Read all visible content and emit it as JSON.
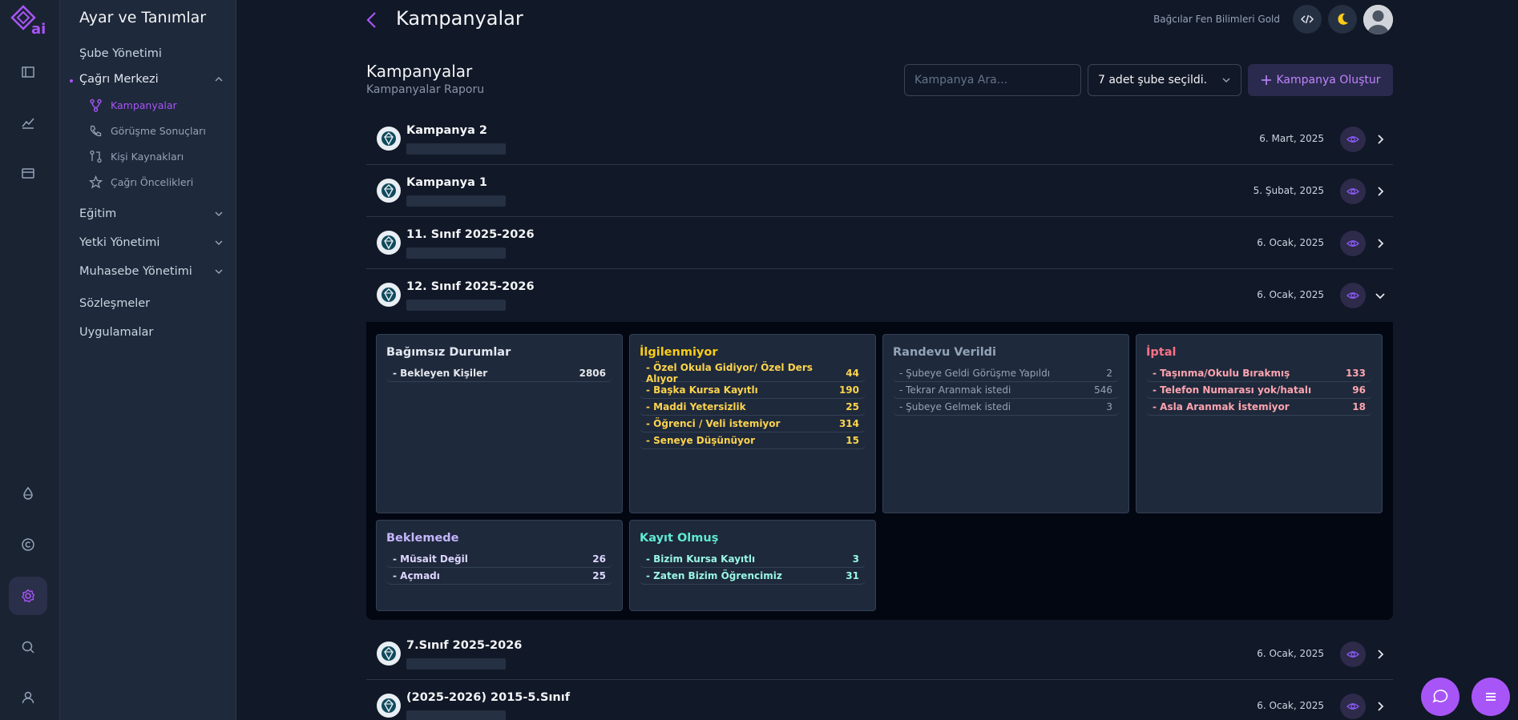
{
  "sidebar": {
    "title": "Ayar ve Tanımlar",
    "items": [
      {
        "label": "Şube Yönetimi"
      },
      {
        "label": "Çağrı Merkezi"
      },
      {
        "label": "Eğitim"
      },
      {
        "label": "Yetki Yönetimi"
      },
      {
        "label": "Muhasebe Yönetimi"
      },
      {
        "label": "Sözleşmeler"
      },
      {
        "label": "Uygulamalar"
      }
    ],
    "subitems": [
      {
        "label": "Kampanyalar",
        "icon": "branch-icon"
      },
      {
        "label": "Görüşme Sonuçları",
        "icon": "phone-icon"
      },
      {
        "label": "Kişi Kaynakları",
        "icon": "git-compare-icon"
      },
      {
        "label": "Çağrı Öncelikleri",
        "icon": "star-icon"
      }
    ]
  },
  "header": {
    "title": "Kampanyalar",
    "org": "Bağcılar Fen Bilimleri Gold"
  },
  "section": {
    "title": "Kampanyalar",
    "subtitle": "Kampanyalar Raporu",
    "search_placeholder": "Kampanya Ara...",
    "branch_select": "7 adet şube seçildi.",
    "create_label": "Kampanya Oluştur"
  },
  "campaigns": [
    {
      "name": "Kampanya 2",
      "date": "6. Mart, 2025"
    },
    {
      "name": "Kampanya 1",
      "date": "5. Şubat, 2025"
    },
    {
      "name": "11. Sınıf 2025-2026",
      "date": "6. Ocak, 2025"
    },
    {
      "name": "12. Sınıf 2025-2026",
      "date": "6. Ocak, 2025"
    },
    {
      "name": "7.Sınıf 2025-2026",
      "date": "6. Ocak, 2025"
    },
    {
      "name": "(2025-2026) 2015-5.Sınıf",
      "date": "6. Ocak, 2025"
    }
  ],
  "groups": [
    {
      "title": "Bağımsız Durumlar",
      "rows": [
        [
          "- Bekleyen Kişiler",
          "2806"
        ]
      ]
    },
    {
      "title": "İlgilenmiyor",
      "rows": [
        [
          "- Özel Okula Gidiyor/ Özel Ders Alıyor",
          "44"
        ],
        [
          "- Başka Kursa Kayıtlı",
          "190"
        ],
        [
          "- Maddi Yetersizlik",
          "25"
        ],
        [
          "- Öğrenci / Veli istemiyor",
          "314"
        ],
        [
          "- Seneye Düşünüyor",
          "15"
        ]
      ]
    },
    {
      "title": "Randevu Verildi",
      "rows": [
        [
          "- Şubeye Geldi Görüşme Yapıldı",
          "2"
        ],
        [
          "- Tekrar Aranmak istedi",
          "546"
        ],
        [
          "- Şubeye Gelmek istedi",
          "3"
        ]
      ]
    },
    {
      "title": "İptal",
      "rows": [
        [
          "- Taşınma/Okulu Bırakmış",
          "133"
        ],
        [
          "- Telefon Numarası yok/hatalı",
          "96"
        ],
        [
          "- Asla Aranmak İstemiyor",
          "18"
        ]
      ]
    },
    {
      "title": "Beklemede",
      "rows": [
        [
          "- Müsait Değil",
          "26"
        ],
        [
          "- Açmadı",
          "25"
        ]
      ]
    },
    {
      "title": "Kayıt Olmuş",
      "rows": [
        [
          "- Bizim Kursa Kayıtlı",
          "3"
        ],
        [
          "- Zaten Bizim Öğrencimiz",
          "31"
        ]
      ]
    }
  ],
  "colors": {
    "accent": "#a855f7"
  }
}
